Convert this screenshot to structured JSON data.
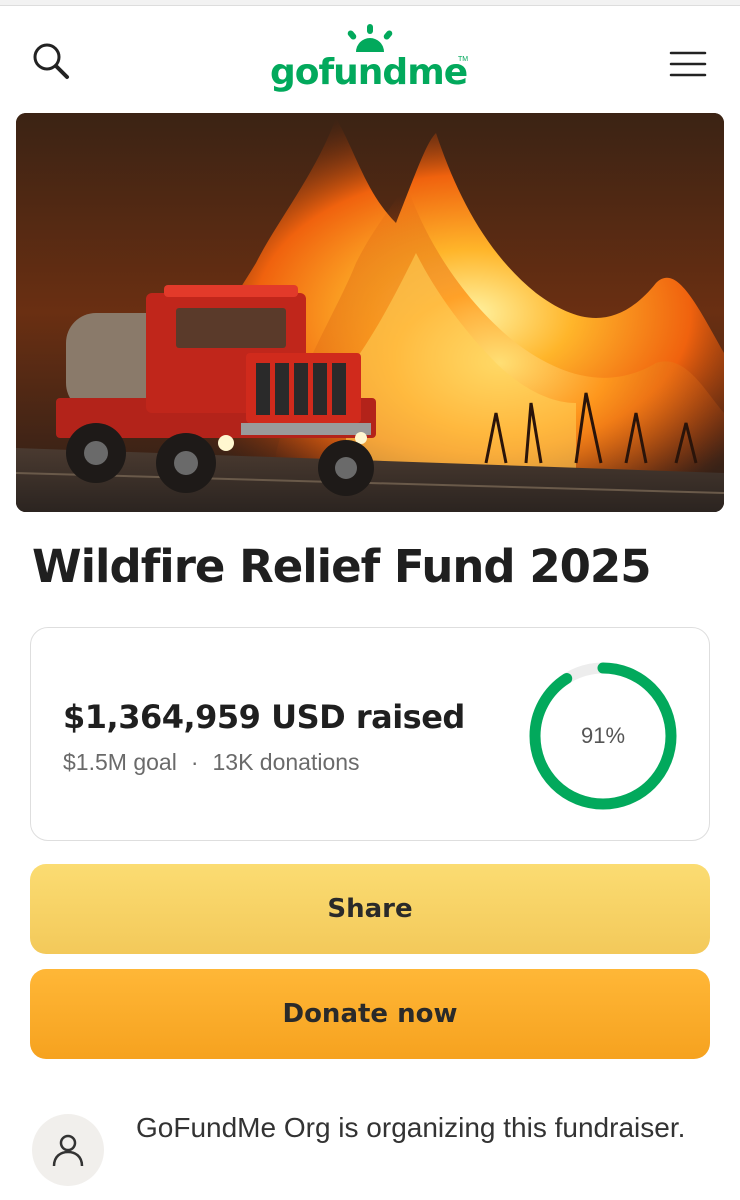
{
  "header": {
    "logo_text": "gofundme",
    "logo_tm": "TM",
    "brand_color": "#02a95c",
    "icons": [
      "search-icon",
      "menu-icon"
    ]
  },
  "campaign": {
    "title": "Wildfire Relief Fund 2025",
    "image": "wildfire-fire-truck-photo"
  },
  "stats": {
    "raised": "$1,364,959 USD raised",
    "goal": "$1.5M goal",
    "separator": "·",
    "donations": "13K donations",
    "progress_label": "91%",
    "progress_fraction": 0.91,
    "progress_color": "#02a95c"
  },
  "buttons": {
    "share": "Share",
    "donate": "Donate now"
  },
  "organizer": {
    "text": "GoFundMe Org is organizing this fundraiser.",
    "avatar_icon": "person-icon"
  }
}
